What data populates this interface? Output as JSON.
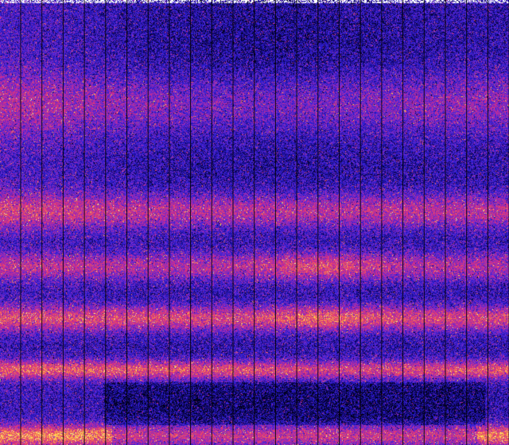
{
  "image": {
    "kind": "spectrogram",
    "colormap": [
      "#00001a",
      "#1a0a8c",
      "#2a20d8",
      "#6a2ad0",
      "#b02aa8",
      "#e0307a",
      "#f26a55",
      "#ffd040",
      "#ffff9a"
    ],
    "background": "#00006a",
    "gridline_color": "#000000",
    "top_edge_color": "#ffffff"
  },
  "bands": [
    {
      "name": "band-upper",
      "level": 0.42
    },
    {
      "name": "band-middle-upper",
      "level": 0.58
    },
    {
      "name": "band-middle",
      "level": 0.72
    },
    {
      "name": "band-lower-middle",
      "level": 0.86
    },
    {
      "name": "band-lower",
      "level": 0.9
    },
    {
      "name": "band-bottom",
      "level": 0.98
    }
  ],
  "gridlines": {
    "count": 24
  }
}
